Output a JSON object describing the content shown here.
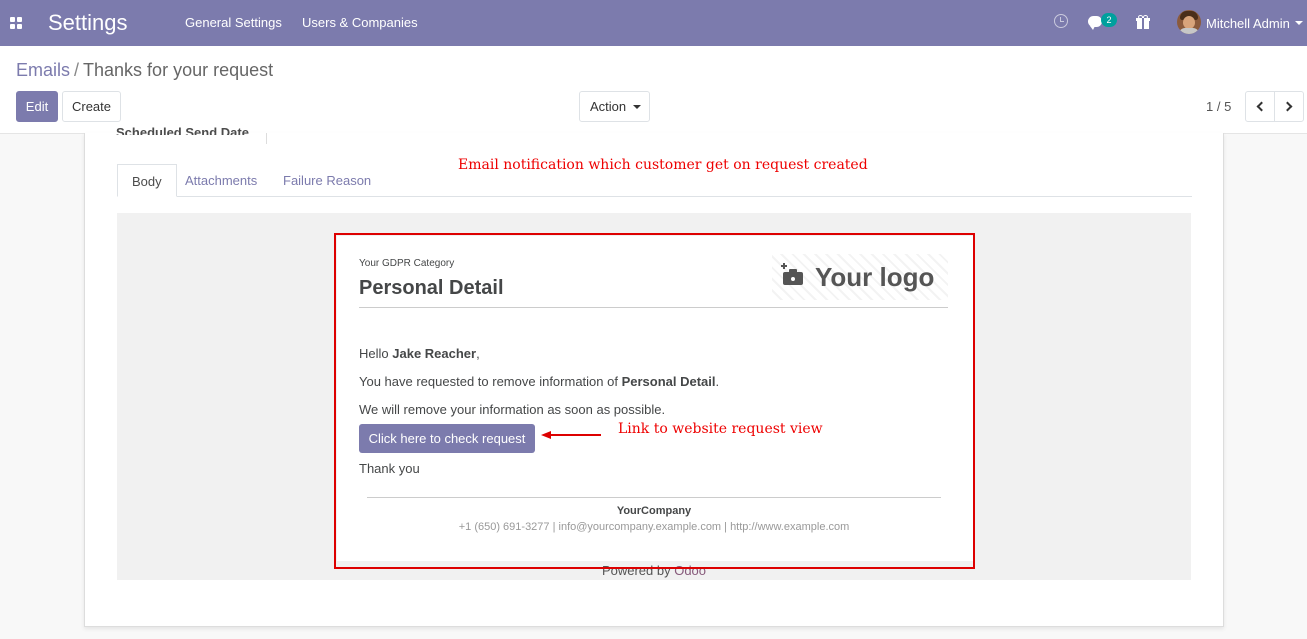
{
  "navbar": {
    "app_title": "Settings",
    "menus": [
      "General Settings",
      "Users & Companies"
    ],
    "chat_count": "2",
    "user_name": "Mitchell Admin",
    "bg_color": "#7c7bad"
  },
  "control_panel": {
    "breadcrumb": {
      "parent": "Emails",
      "separator": "/",
      "current": "Thanks for your request"
    },
    "edit_label": "Edit",
    "create_label": "Create",
    "action_label": "Action",
    "pager": "1 / 5"
  },
  "form": {
    "scheduled_label": "Scheduled Send Date",
    "tabs": [
      "Body",
      "Attachments",
      "Failure Reason"
    ]
  },
  "annotations": {
    "top": "Email notification which customer get on request created",
    "link": "Link to website request view"
  },
  "email": {
    "category": "Your GDPR Category",
    "title": "Personal Detail",
    "logo_text": "Your logo",
    "greeting_prefix": "Hello ",
    "customer_name": "Jake Reacher",
    "greeting_suffix": ",",
    "line1_prefix": "You have requested to remove information of ",
    "line1_bold": "Personal Detail",
    "line1_suffix": ".",
    "line2": "We will remove your information as soon as possible.",
    "button_label": "Click here to check request",
    "thanks": "Thank you",
    "company": "YourCompany",
    "contact": "+1 (650) 691-3277 | info@yourcompany.example.com | http://www.example.com",
    "powered_prefix": "Powered by ",
    "powered_brand": "Odoo"
  },
  "icons": [
    "apps-icon",
    "clock-icon",
    "chat-icon",
    "gift-icon",
    "camera-icon",
    "chevron-left-icon",
    "chevron-right-icon"
  ],
  "colors": {
    "accent": "#7c7bad",
    "annotation": "#dd0000",
    "badge": "#00a09d"
  }
}
